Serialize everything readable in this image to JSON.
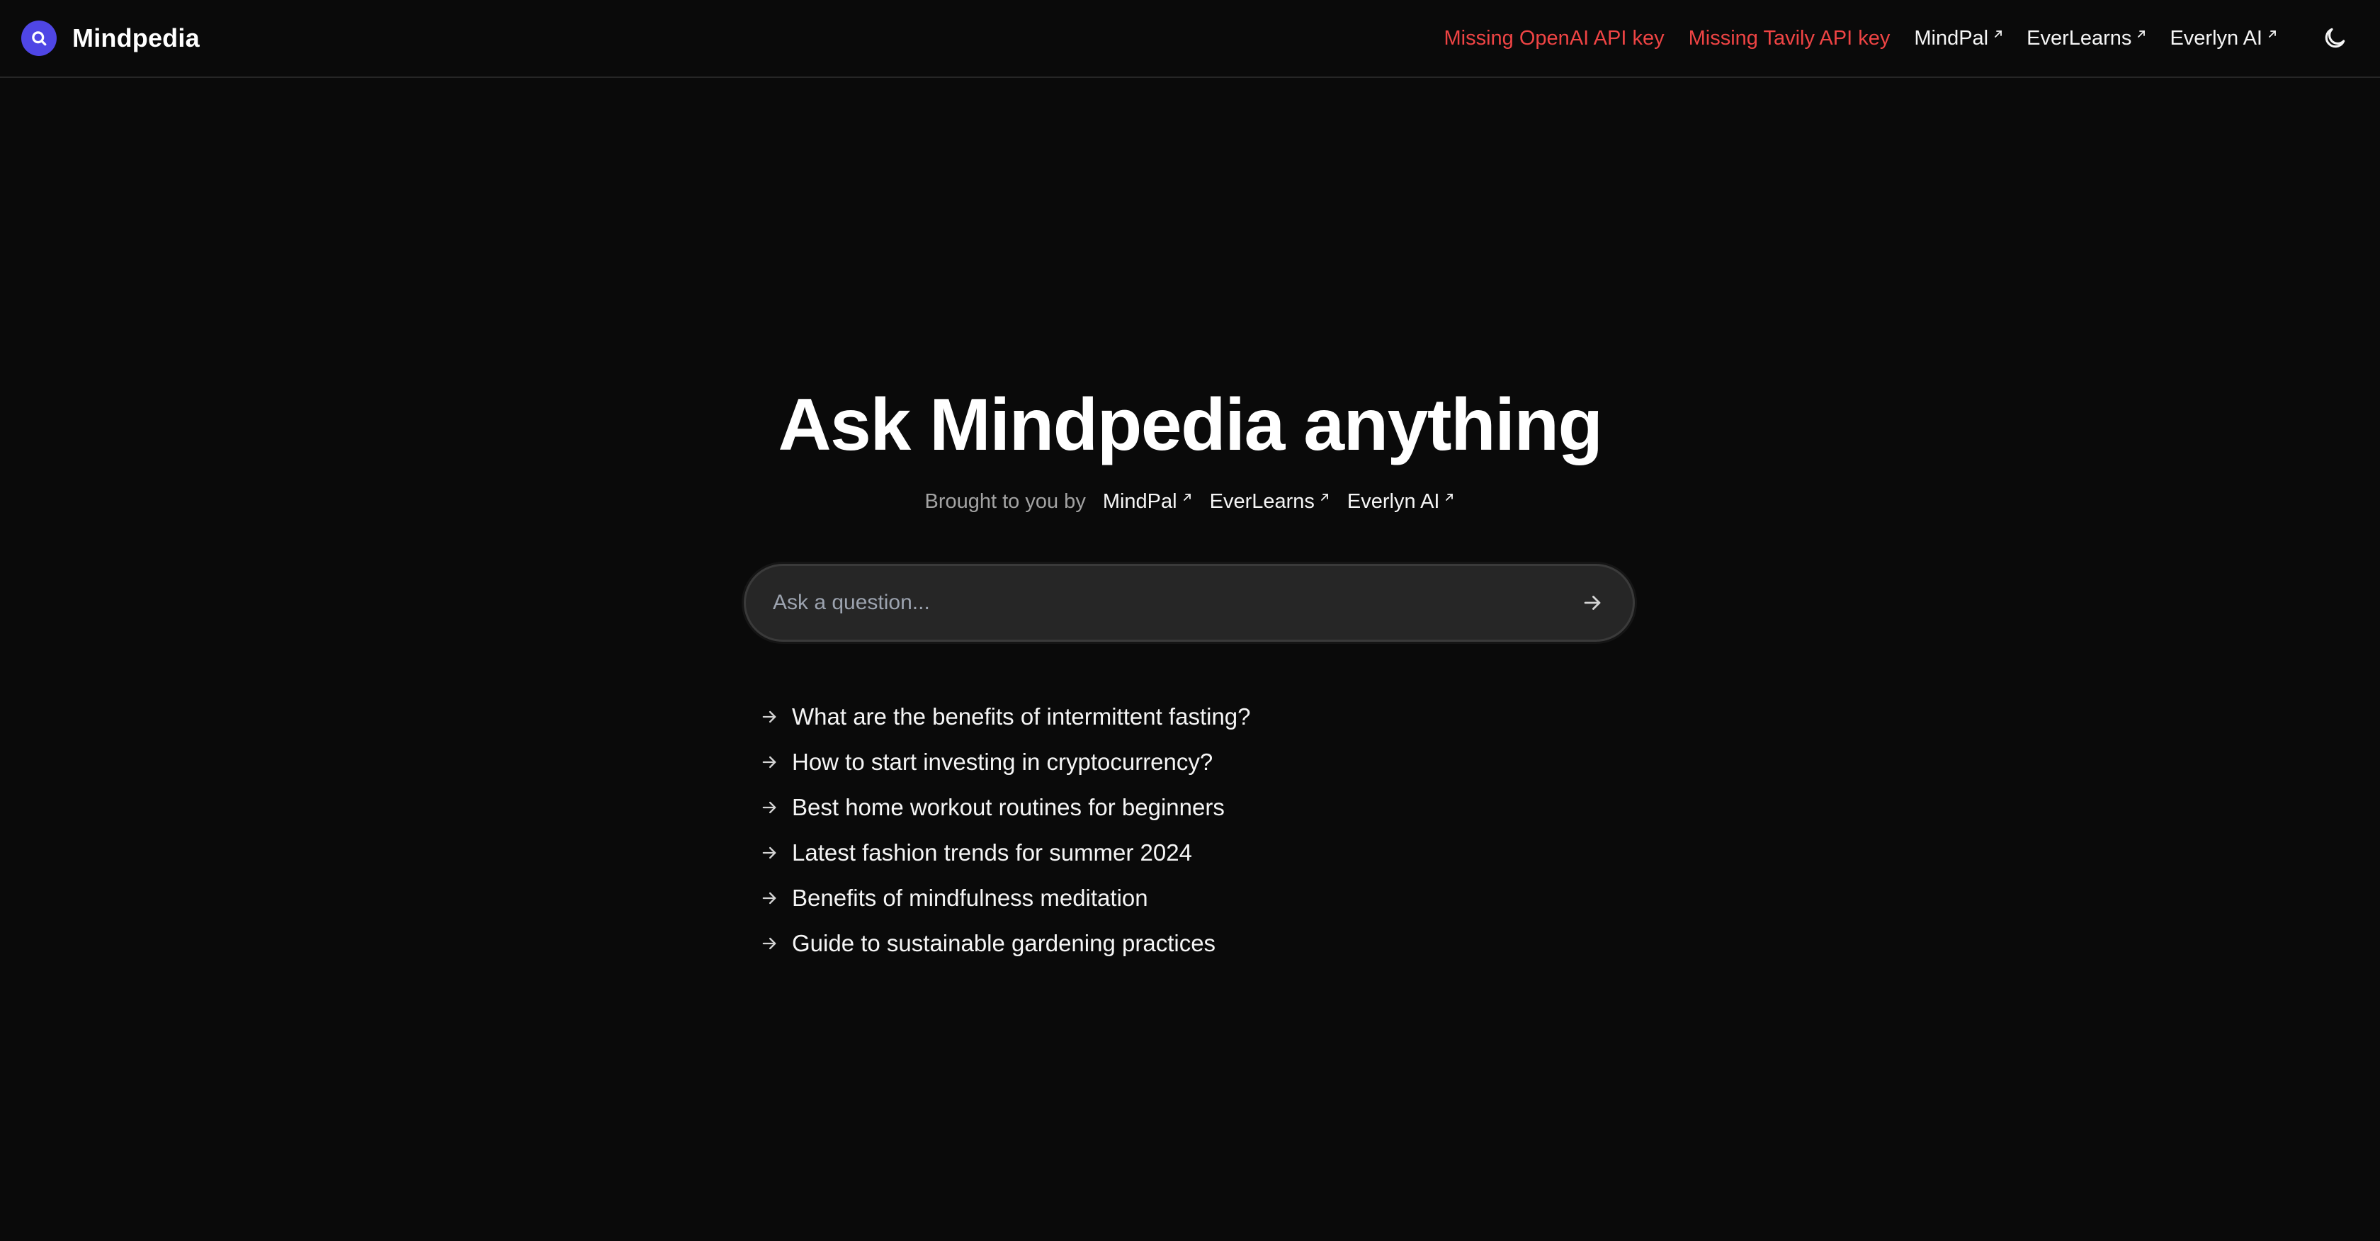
{
  "header": {
    "brand_name": "Mindpedia",
    "logo_icon": "search-circle-icon",
    "warnings": [
      "Missing OpenAI API key",
      "Missing Tavily API key"
    ],
    "links": [
      {
        "label": "MindPal"
      },
      {
        "label": "EverLearns"
      },
      {
        "label": "Everlyn AI"
      }
    ],
    "theme_icon": "moon-icon"
  },
  "hero": {
    "title": "Ask Mindpedia anything",
    "byline_prefix": "Brought to you by",
    "byline_links": [
      {
        "label": "MindPal"
      },
      {
        "label": "EverLearns"
      },
      {
        "label": "Everlyn AI"
      }
    ]
  },
  "search": {
    "placeholder": "Ask a question...",
    "value": "",
    "submit_icon": "arrow-right-icon"
  },
  "suggestions": [
    "What are the benefits of intermittent fasting?",
    "How to start investing in cryptocurrency?",
    "Best home workout routines for beginners",
    "Latest fashion trends for summer 2024",
    "Benefits of mindfulness meditation",
    "Guide to sustainable gardening practices"
  ],
  "colors": {
    "background": "#0a0a0a",
    "accent": "#4f46e5",
    "warning": "#ef4444",
    "input_background": "#262626"
  }
}
